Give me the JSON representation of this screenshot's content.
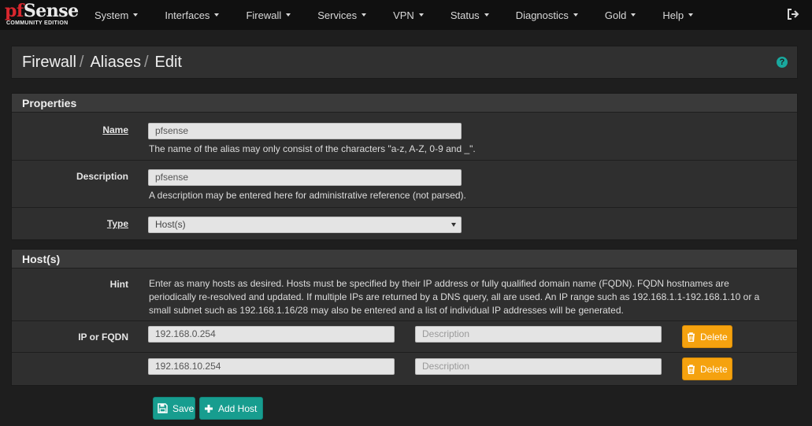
{
  "brand": {
    "logo_pf": "pf",
    "logo_sense": "Sense",
    "logo_sub": "COMMUNITY EDITION"
  },
  "nav": {
    "items": [
      {
        "label": "System"
      },
      {
        "label": "Interfaces"
      },
      {
        "label": "Firewall"
      },
      {
        "label": "Services"
      },
      {
        "label": "VPN"
      },
      {
        "label": "Status"
      },
      {
        "label": "Diagnostics"
      },
      {
        "label": "Gold"
      },
      {
        "label": "Help"
      }
    ],
    "logout_icon": "logout-icon"
  },
  "breadcrumb": {
    "items": [
      "Firewall",
      "Aliases",
      "Edit"
    ],
    "separator": "/",
    "help_icon": "question-icon",
    "help_glyph": "?"
  },
  "properties": {
    "heading": "Properties",
    "name_label": "Name",
    "name_value": "pfsense",
    "name_help": "The name of the alias may only consist of the characters \"a-z, A-Z, 0-9 and _\".",
    "description_label": "Description",
    "description_value": "pfsense",
    "description_help": "A description may be entered here for administrative reference (not parsed).",
    "type_label": "Type",
    "type_value": "Host(s)"
  },
  "hosts": {
    "heading": "Host(s)",
    "hint_label": "Hint",
    "hint_text": "Enter as many hosts as desired. Hosts must be specified by their IP address or fully qualified domain name (FQDN). FQDN hostnames are periodically re-resolved and updated. If multiple IPs are returned by a DNS query, all are used. An IP range such as 192.168.1.1-192.168.1.10 or a small subnet such as 192.168.1.16/28 may also be entered and a list of individual IP addresses will be generated.",
    "ip_label": "IP or FQDN",
    "entries": [
      {
        "address": "192.168.0.254",
        "description_placeholder": "Description",
        "delete_label": "Delete"
      },
      {
        "address": "192.168.10.254",
        "description_placeholder": "Description",
        "delete_label": "Delete"
      }
    ]
  },
  "actions": {
    "save_label": "Save",
    "add_host_label": "Add Host"
  },
  "colors": {
    "navbar": "#101010",
    "panel": "#2f2f2f",
    "accent_teal": "#179d8f",
    "delete_orange": "#f5a20f",
    "logo_red": "#d9272e"
  }
}
